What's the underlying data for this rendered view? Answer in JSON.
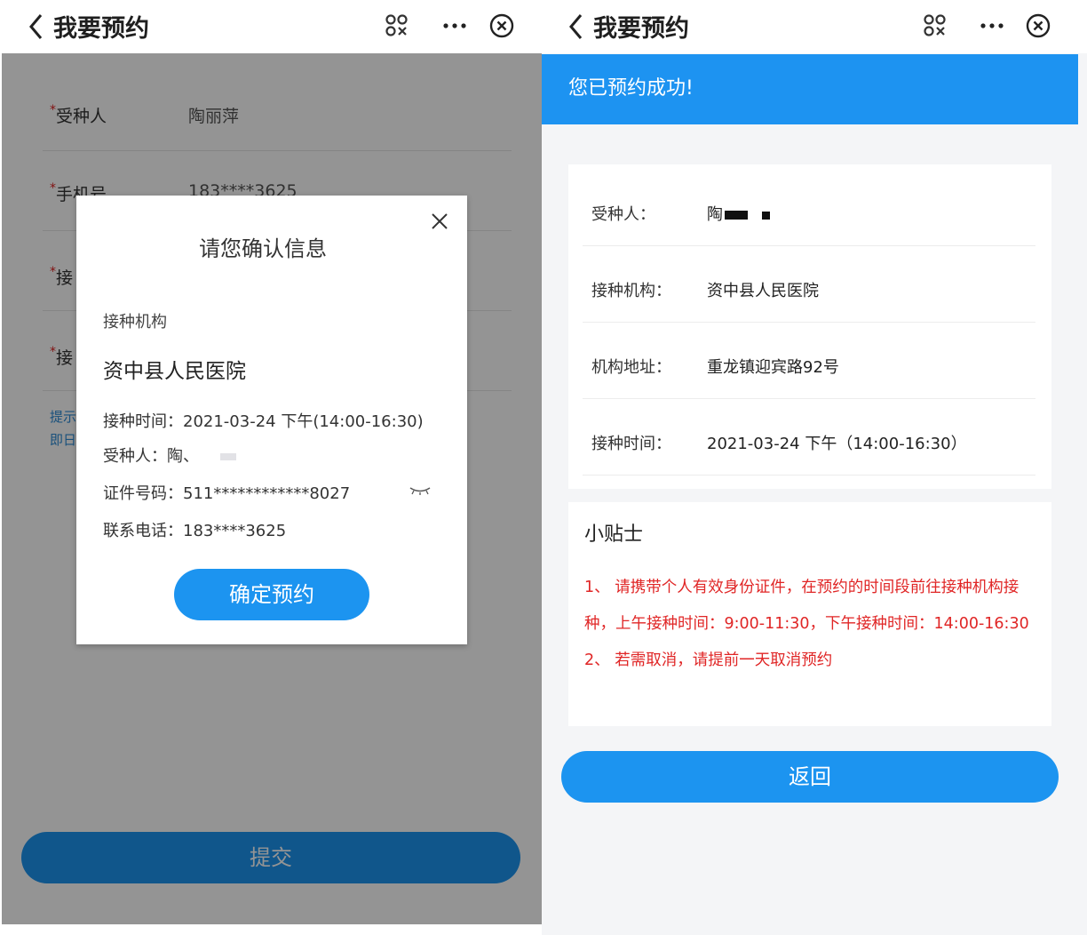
{
  "left": {
    "topbar": {
      "title": "我要预约"
    },
    "form": {
      "recipient_label": "受种人",
      "recipient_value": "陶丽萍",
      "phone_label": "手机号",
      "phone_value": "183****3625",
      "org_label_partial": "接",
      "time_label_partial": "接",
      "hint_line1": "提示",
      "hint_line2": "即日",
      "submit_label": "提交"
    },
    "dialog": {
      "title": "请您确认信息",
      "org_label": "接种机构",
      "org_name": "资中县人民医院",
      "time_line": "接种时间：2021-03-24 下午(14:00-16:30)",
      "recipient_line": "受种人：陶、",
      "id_line": "证件号码：511************8027",
      "phone_line": "联系电话：183****3625",
      "confirm_label": "确定预约"
    }
  },
  "right": {
    "topbar": {
      "title": "我要预约"
    },
    "success_message": "您已预约成功!",
    "details": [
      {
        "label": "受种人：",
        "value": "陶"
      },
      {
        "label": "接种机构：",
        "value": "资中县人民医院"
      },
      {
        "label": "机构地址：",
        "value": "重龙镇迎宾路92号"
      },
      {
        "label": "接种时间：",
        "value": "2021-03-24 下午（14:00-16:30）"
      }
    ],
    "tips": {
      "title": "小贴士",
      "text": "1、 请携带个人有效身份证件，在预约的时间段前往接种机构接种，上午接种时间：9:00-11:30，下午接种时间：14:00-16:30 2、 若需取消，请提前一天取消预约"
    },
    "back_label": "返回"
  },
  "colors": {
    "accent": "#1c94f0",
    "tip_red": "#e02626",
    "success_bar": "#1d93f1"
  }
}
